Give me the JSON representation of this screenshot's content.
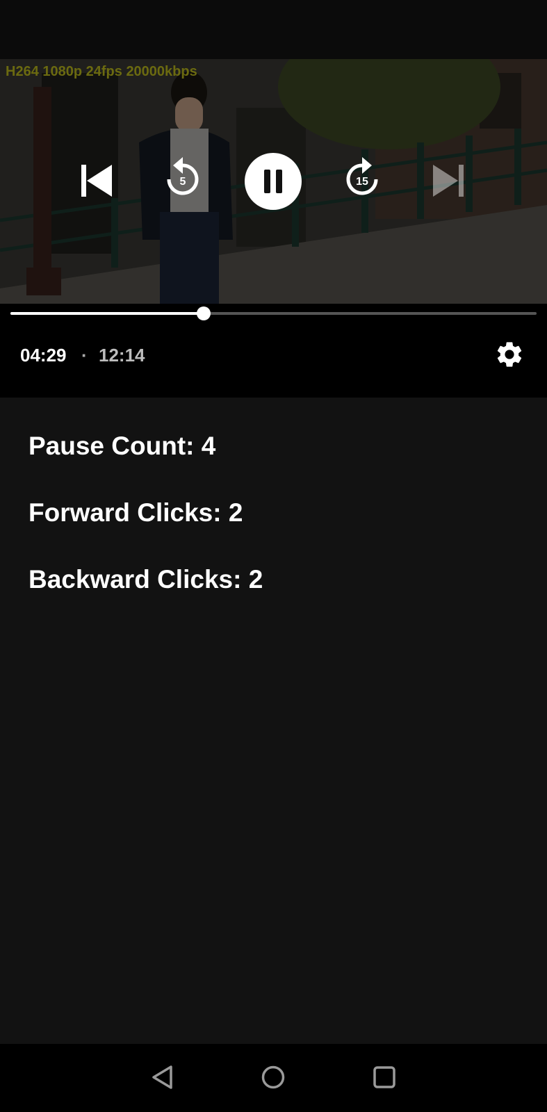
{
  "video": {
    "stream_info": "H264 1080p 24fps  20000kbps",
    "controls": {
      "skip_back_seconds": "5",
      "skip_forward_seconds": "15",
      "state": "playing"
    },
    "progress": {
      "current_time": "04:29",
      "separator": "·",
      "total_time": "12:14",
      "fraction": 0.367
    }
  },
  "stats": {
    "pause_count": "Pause Count: 4",
    "forward_clicks": "Forward Clicks: 2",
    "backward_clicks": "Backward Clicks: 2"
  },
  "icons": {
    "previous": "skip-previous-icon",
    "rewind": "replay-5-icon",
    "pause": "pause-icon",
    "forward": "forward-15-icon",
    "next": "skip-next-icon",
    "settings": "gear-icon",
    "nav_back": "triangle-back-icon",
    "nav_home": "circle-home-icon",
    "nav_recents": "square-recents-icon"
  },
  "colors": {
    "stream_info_text": "#6b6a10",
    "background": "#121212",
    "controls_background": "#000000"
  }
}
